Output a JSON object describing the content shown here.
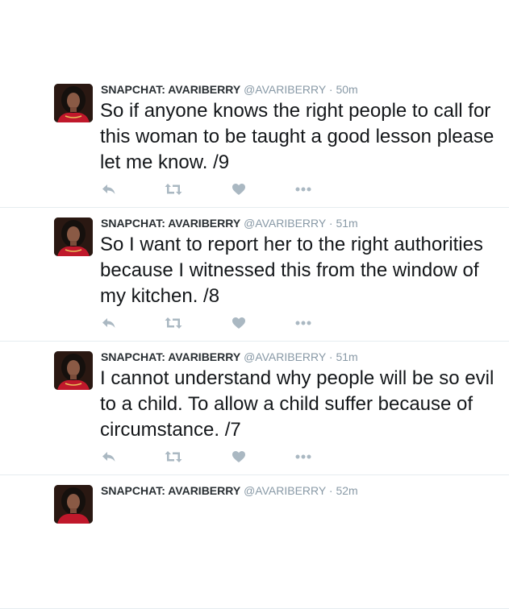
{
  "tweets": [
    {
      "fullname": "SNAPCHAT: AVARIBERRY",
      "username": "@AVARIBERRY",
      "separator": "·",
      "time": "50m",
      "text": "So if anyone knows the right people to call for this woman to be taught a good lesson please let me know. /9"
    },
    {
      "fullname": "SNAPCHAT: AVARIBERRY",
      "username": "@AVARIBERRY",
      "separator": "·",
      "time": "51m",
      "text": "So I want to report her to the right authorities because I witnessed this from the window of my kitchen. /8"
    },
    {
      "fullname": "SNAPCHAT: AVARIBERRY",
      "username": "@AVARIBERRY",
      "separator": "·",
      "time": "51m",
      "text": "I cannot understand why people will be so evil to a child. To allow a child suffer because of circumstance. /7"
    },
    {
      "fullname": "SNAPCHAT: AVARIBERRY",
      "username": "@AVARIBERRY",
      "separator": "·",
      "time": "52m",
      "text": ""
    }
  ],
  "icons": {
    "reply": "reply-icon",
    "retweet": "retweet-icon",
    "like": "heart-icon",
    "more": "more-icon"
  },
  "colors": {
    "icon": "#aab8c2",
    "meta": "#8899a6",
    "name": "#292f33",
    "text": "#14171a"
  }
}
